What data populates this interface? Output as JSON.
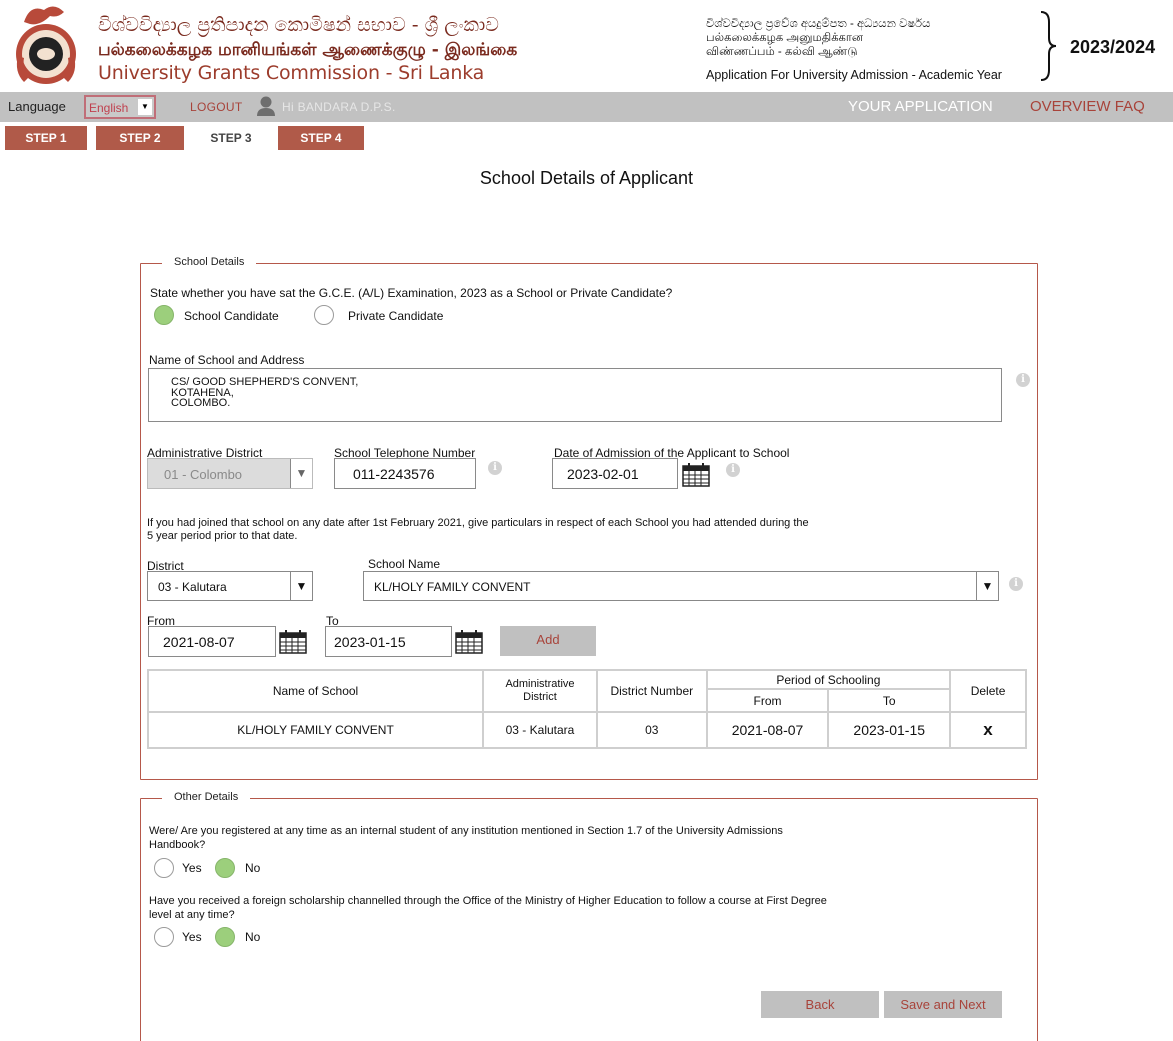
{
  "header": {
    "title_si": "විශ්වවිද්‍යාල ප්‍රතිපාදන කොමිෂන් සභාව - ශ්‍රී ලංකාව",
    "title_ta": "பல்கலைக்கழக மானியங்கள் ஆணைக்குழு - இலங்கை",
    "title_en": "University Grants Commission - Sri Lanka",
    "app_si": "විශ්වවිද්‍යාල ප්‍රවේශ අයදුම්පත - අධ්‍යයන වර්ෂය",
    "app_ta1": "பல்கலைக்கழக அனுமதிக்கான",
    "app_ta2": "விண்ணப்பம் - கல்வி ஆண்டு",
    "app_en": "Application For University Admission - Academic Year",
    "year": "2023/2024"
  },
  "menubar": {
    "language_label": "Language",
    "language_value": "English",
    "logout": "LOGOUT",
    "greeting": "Hi BANDARA D.P.S.",
    "your_application": "YOUR APPLICATION",
    "overview_faq": "OVERVIEW FAQ"
  },
  "steps": [
    "STEP 1",
    "STEP 2",
    "STEP 3",
    "STEP 4"
  ],
  "page_title": "School Details of Applicant",
  "school_details": {
    "legend": "School Details",
    "candidate_question": "State whether you have sat the G.C.E. (A/L) Examination, 2023 as a School or Private Candidate?",
    "school_candidate": "School Candidate",
    "private_candidate": "Private Candidate",
    "name_label": "Name of School and Address",
    "address_lines": [
      "CS/ GOOD SHEPHERD'S CONVENT,",
      "KOTAHENA,",
      "COLOMBO."
    ],
    "district_label": "Administrative District",
    "district_value": "01 - Colombo",
    "phone_label": "School Telephone Number",
    "phone_value": "011-2243576",
    "admission_label": "Date of Admission of the Applicant to School",
    "admission_value": "2023-02-01",
    "prior_note_1": "If you had joined that school on any date after 1st February 2021, give particulars in respect of each School you had attended during the",
    "prior_note_2": "5 year period prior to that date.",
    "prev_district_label": "District",
    "prev_district_value": "03 - Kalutara",
    "prev_school_label": "School Name",
    "prev_school_value": "KL/HOLY FAMILY CONVENT",
    "from_label": "From",
    "from_value": "2021-08-07",
    "to_label": "To",
    "to_value": "2023-01-15",
    "add_button": "Add",
    "table": {
      "col_name": "Name of School",
      "col_admin_1": "Administrative",
      "col_admin_2": "District",
      "col_district_no": "District Number",
      "col_period": "Period of Schooling",
      "col_from": "From",
      "col_to": "To",
      "col_delete": "Delete",
      "rows": [
        {
          "name": "KL/HOLY FAMILY CONVENT",
          "admin_district": "03 - Kalutara",
          "district_no": "03",
          "from": "2021-08-07",
          "to": "2023-01-15",
          "delete": "x"
        }
      ]
    }
  },
  "other_details": {
    "legend": "Other Details",
    "q1_line1": "Were/ Are you registered at any time as an internal student of any institution mentioned in Section 1.7 of the University Admissions",
    "q1_line2": "Handbook?",
    "q2_line1": "Have you received a foreign scholarship channelled through the Office of the Ministry of Higher Education to follow a course at First Degree",
    "q2_line2": "level at any time?",
    "yes": "Yes",
    "no": "No"
  },
  "buttons": {
    "back": "Back",
    "save_next": "Save and Next"
  }
}
